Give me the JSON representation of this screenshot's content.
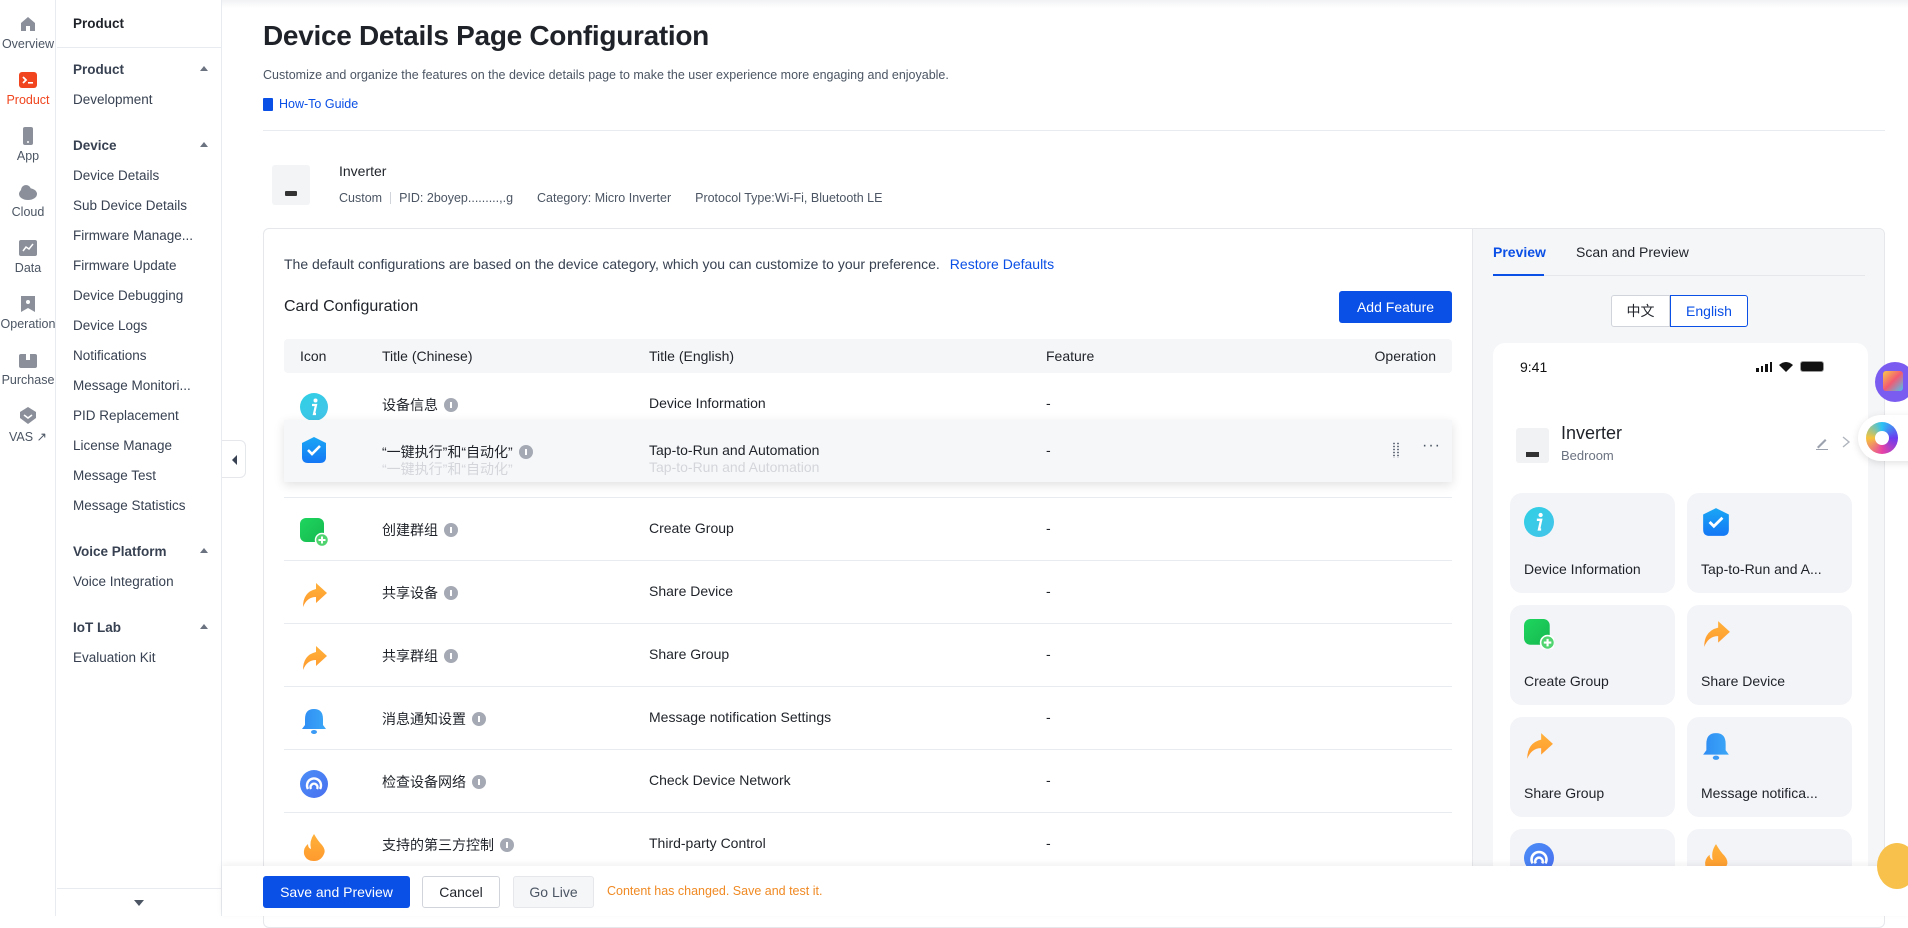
{
  "rail": {
    "items": [
      {
        "label": "Overview",
        "icon": "home-icon"
      },
      {
        "label": "Product",
        "icon": "terminal-icon",
        "active": true
      },
      {
        "label": "App",
        "icon": "phone-icon"
      },
      {
        "label": "Cloud",
        "icon": "cloud-icon"
      },
      {
        "label": "Data",
        "icon": "chart-icon"
      },
      {
        "label": "Operation",
        "icon": "bookmark-star-icon"
      },
      {
        "label": "Purchase",
        "icon": "box-icon"
      },
      {
        "label": "VAS ↗",
        "icon": "shield-down-icon"
      }
    ],
    "active_color": "#f0451e"
  },
  "subnav": {
    "title": "Product",
    "groups": [
      {
        "label": "Product",
        "items": [
          "Development"
        ]
      },
      {
        "label": "Device",
        "items": [
          "Device Details",
          "Sub Device Details",
          "Firmware Manage...",
          "Firmware Update",
          "Device Debugging",
          "Device Logs",
          "Notifications",
          "Message Monitori...",
          "PID Replacement",
          "License Manage",
          "Message Test",
          "Message Statistics"
        ]
      },
      {
        "label": "Voice Platform",
        "items": [
          "Voice Integration"
        ]
      },
      {
        "label": "IoT Lab",
        "items": [
          "Evaluation Kit"
        ]
      }
    ]
  },
  "header": {
    "title": "Device Details Page Configuration",
    "description": "Customize and organize the features on the device details page to make the user experience more engaging and enjoyable.",
    "guide_link": "How-To Guide"
  },
  "product": {
    "name": "Inverter",
    "type": "Custom",
    "pid": "PID: 2boyep.........,.g",
    "category": "Category: Micro Inverter",
    "protocol": "Protocol Type:Wi-Fi, Bluetooth LE"
  },
  "config": {
    "notice": "The default configurations are based on the device category, which you can customize to your preference.",
    "restore_link": "Restore Defaults",
    "section_title": "Card Configuration",
    "add_button": "Add Feature",
    "columns": [
      "Icon",
      "Title (Chinese)",
      "Title (English)",
      "Feature",
      "Operation"
    ],
    "rows": [
      {
        "icon": "info-icon",
        "zh": "设备信息",
        "en": "Device Information",
        "feature": "-"
      },
      {
        "icon": "check-shield-icon",
        "zh": "“一键执行”和“自动化”",
        "en": "Tap-to-Run and Automation",
        "feature": "-",
        "dragging": true
      },
      {
        "icon": "create-group-icon",
        "zh": "创建群组",
        "en": "Create Group",
        "feature": "-"
      },
      {
        "icon": "share-icon",
        "zh": "共享设备",
        "en": "Share Device",
        "feature": "-"
      },
      {
        "icon": "share-icon",
        "zh": "共享群组",
        "en": "Share Group",
        "feature": "-"
      },
      {
        "icon": "bell-icon",
        "zh": "消息通知设置",
        "en": "Message notification Settings",
        "feature": "-"
      },
      {
        "icon": "network-icon",
        "zh": "检查设备网络",
        "en": "Check Device Network",
        "feature": "-"
      },
      {
        "icon": "flame-icon",
        "zh": "支持的第三方控制",
        "en": "Third-party Control",
        "feature": "-"
      }
    ],
    "more_label": "···"
  },
  "preview": {
    "tabs": [
      "Preview",
      "Scan and Preview"
    ],
    "active_tab": 0,
    "languages": [
      "中文",
      "English"
    ],
    "selected_language": "English",
    "phone": {
      "time": "9:41",
      "device_name": "Inverter",
      "room": "Bedroom",
      "tiles": [
        {
          "label": "Device Information",
          "icon": "info-icon"
        },
        {
          "label": "Tap-to-Run and A...",
          "icon": "check-shield-icon"
        },
        {
          "label": "Create Group",
          "icon": "create-group-icon"
        },
        {
          "label": "Share Device",
          "icon": "share-icon"
        },
        {
          "label": "Share Group",
          "icon": "share-icon"
        },
        {
          "label": "Message notifica...",
          "icon": "bell-icon"
        },
        {
          "label": "",
          "icon": "network-icon"
        },
        {
          "label": "",
          "icon": "flame-icon"
        }
      ]
    }
  },
  "footer": {
    "save": "Save and Preview",
    "cancel": "Cancel",
    "go_live": "Go Live",
    "message": "Content has changed. Save and test it."
  },
  "colors": {
    "primary": "#0a4fe6",
    "warning": "#f08a24",
    "brand": "#f0451e"
  }
}
